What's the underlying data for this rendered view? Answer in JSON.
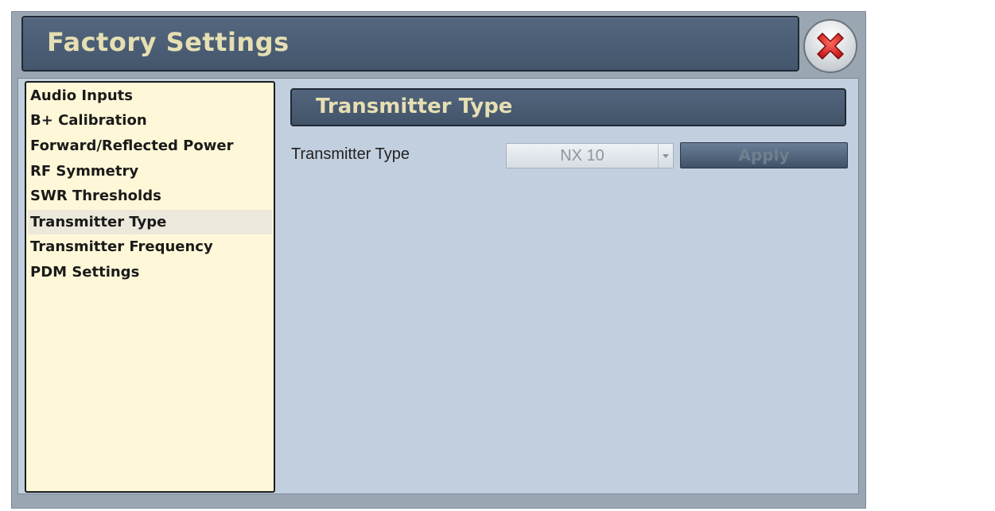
{
  "window": {
    "title": "Factory Settings",
    "close_icon": "close-icon"
  },
  "sidebar": {
    "items": [
      {
        "label": "Audio Inputs",
        "selected": false
      },
      {
        "label": "B+ Calibration",
        "selected": false
      },
      {
        "label": "Forward/Reflected Power",
        "selected": false
      },
      {
        "label": "RF Symmetry",
        "selected": false
      },
      {
        "label": "SWR Thresholds",
        "selected": false
      },
      {
        "label": "Transmitter Type",
        "selected": true
      },
      {
        "label": "Transmitter Frequency",
        "selected": false
      },
      {
        "label": "PDM Settings",
        "selected": false
      }
    ]
  },
  "main": {
    "section_title": "Transmitter Type",
    "field_label": "Transmitter Type",
    "select_value": "NX 10",
    "apply_label": "Apply"
  },
  "colors": {
    "title_text": "#e6dfb3",
    "title_bar": "#4a5d75",
    "sidebar_bg": "#fff8d8",
    "content_bg": "#c2cfdf",
    "close_red": "#d42a2a"
  }
}
